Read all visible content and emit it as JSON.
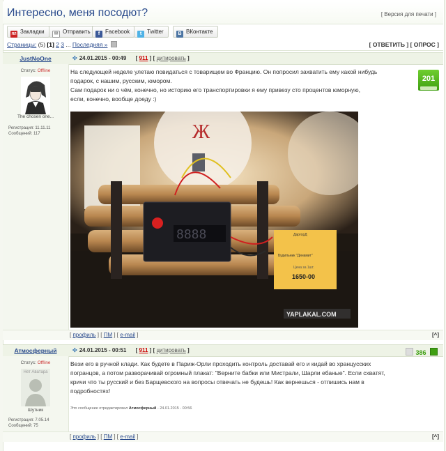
{
  "topic": {
    "title": "Интересно, меня посодют?",
    "print_version": "[ Версия для печати ]"
  },
  "share": [
    {
      "label": "Закладки",
      "icon": "bookmark-icon",
      "color": "#cc2222",
      "glyph": "ЯЛ"
    },
    {
      "label": "Отправить",
      "icon": "mail-icon",
      "color": "#8a8a8a",
      "glyph": "✉"
    },
    {
      "label": "Facebook",
      "icon": "facebook-icon",
      "color": "#3b5998",
      "glyph": "f"
    },
    {
      "label": "Twitter",
      "icon": "twitter-icon",
      "color": "#4fb2e6",
      "glyph": "t"
    },
    {
      "label": "ВКонтакте",
      "icon": "vk-icon",
      "color": "#4c75a3",
      "glyph": "В"
    }
  ],
  "pager": {
    "label": "Страницы:",
    "count": "(5)",
    "current": "[1]",
    "p2": "2",
    "p3": "3",
    "dots": "...",
    "last": "Последняя »",
    "actions": "[ ОТВЕТИТЬ ] [ ОПРОС ]"
  },
  "posts": [
    {
      "author": "JustNoOne",
      "date": "24.01.2015 - 00:49",
      "num": "911",
      "quote": "цитировать",
      "status_label": "Статус:",
      "status": "Offline",
      "user_title": "The chosen one...",
      "reg": "Регистрация: 11.11.11",
      "msgs": "Сообщений: 117",
      "rating": "201",
      "text": [
        "На следующей неделе улетаю повидаться с товарищем во Францию. Он попросил захватить ему какой нибудь",
        "подарок, с нашим, русским, юмором.",
        "Сам подарок ни о чём, конечно, но историю его транспортировки я ему привезу сто процентов юморную,",
        "если, конечно, вообще доеду :)"
      ],
      "photo": {
        "watermark": "YAPLAKAL.COM",
        "price_tag_title": "ДаргорД",
        "price_tag_name": "Будильник \"Динамит\"",
        "price_label": "Цена за 1шт.",
        "price": "1650-00",
        "sign": "Ж"
      },
      "footer": {
        "profile": "профиль",
        "pm": "ПМ",
        "email": "e-mail",
        "up": "[^]"
      }
    },
    {
      "author": "Атмосферный",
      "date": "24.01.2015 - 00:51",
      "num": "911",
      "quote": "цитировать",
      "status_label": "Статус:",
      "status": "Offline",
      "avatar_text": "Нет Аватара",
      "user_title": "Шутник",
      "reg": "Регистрация: 7.05.14",
      "msgs": "Сообщений: 75",
      "score": "386",
      "text": [
        "Вези его в ручной клади. Как будете в Париж-Орли проходить контроль доставай его и кидай во хранцусских",
        "погранцов, а потом разворачивай огромный плакат: \"Верните бабки или Мистрали, Шарли ебаные\". Если схватят,",
        "кричи что ты русский и без Барщевского на вопросы отвечать не будешь! Как вернешься - отпишись нам в",
        "подробностях!"
      ],
      "edited_prefix": "Это сообщение отредактировал",
      "edited_by": "Атмосферный",
      "edited_date": "- 24.01.2015 - 00:56",
      "footer": {
        "profile": "профиль",
        "pm": "ПМ",
        "email": "e-mail",
        "up": "[^]"
      }
    }
  ]
}
